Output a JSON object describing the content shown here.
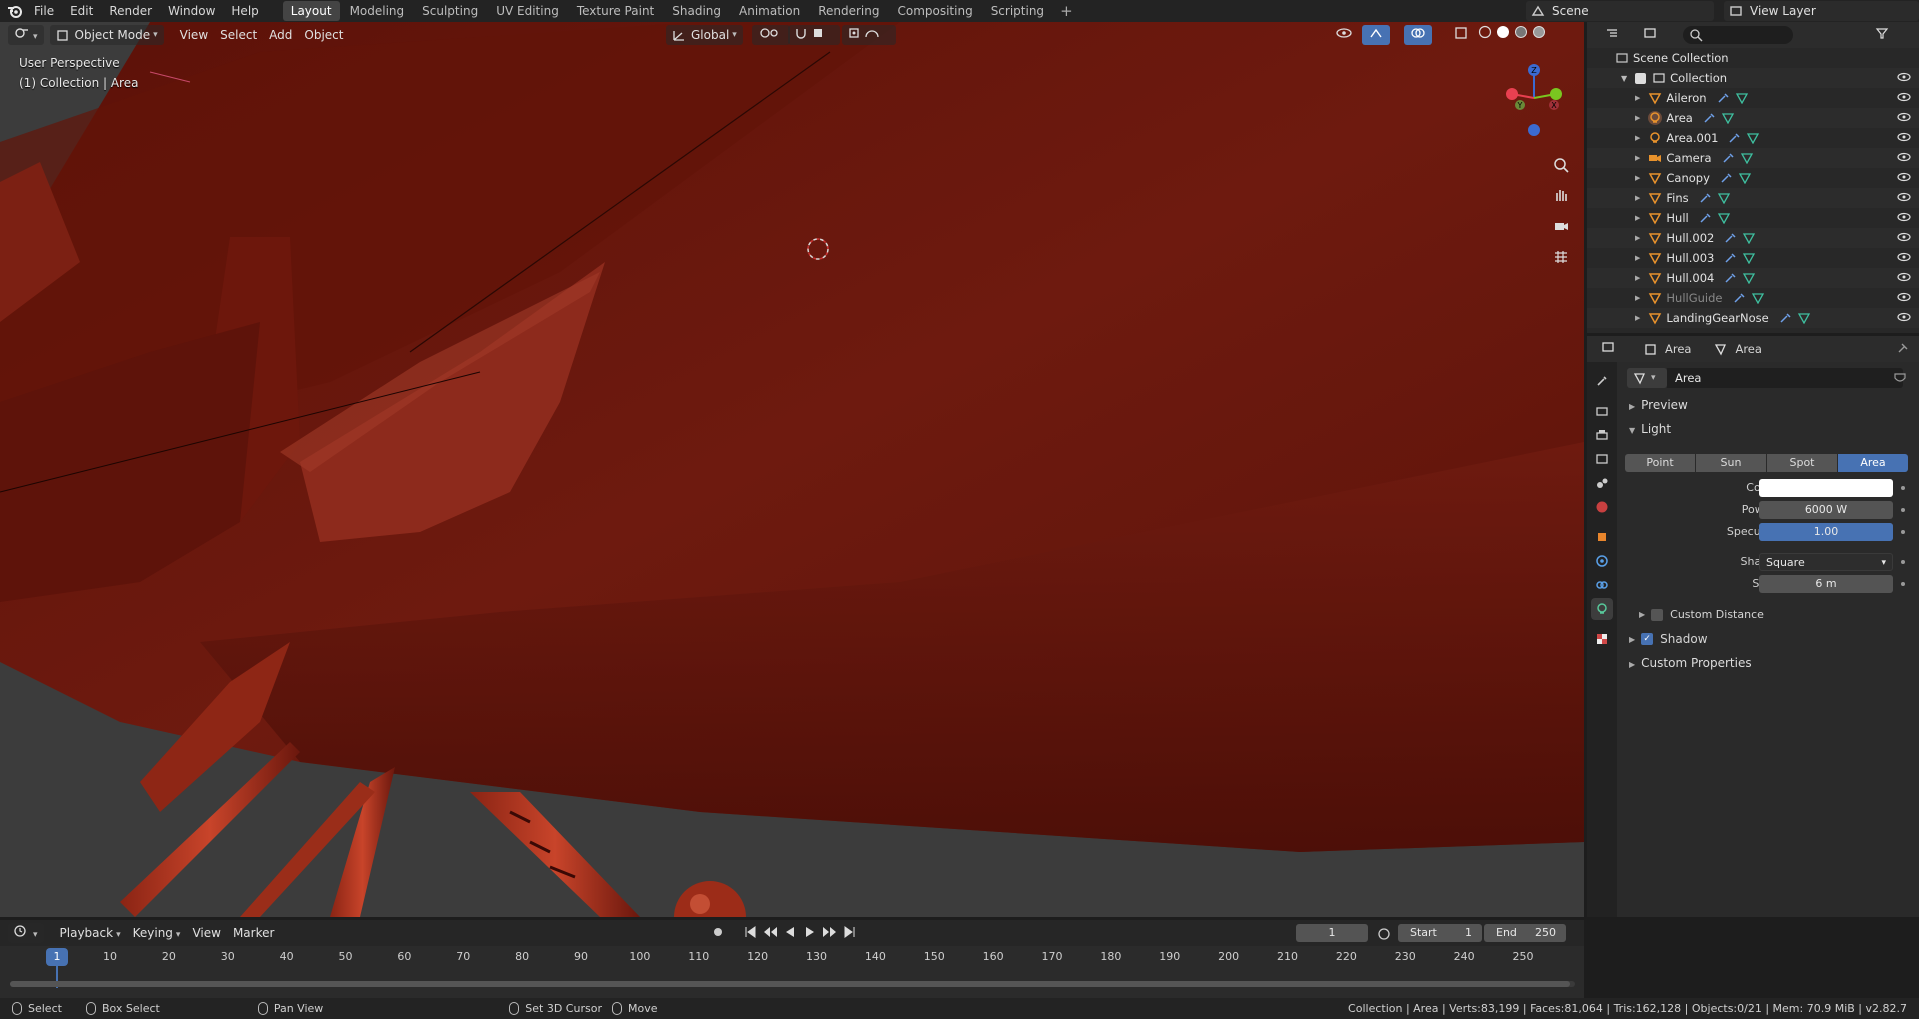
{
  "topbar": {
    "menus": [
      "File",
      "Edit",
      "Render",
      "Window",
      "Help"
    ],
    "workspaces": [
      "Layout",
      "Modeling",
      "Sculpting",
      "UV Editing",
      "Texture Paint",
      "Shading",
      "Animation",
      "Rendering",
      "Compositing",
      "Scripting"
    ],
    "active_workspace": "Layout",
    "add_tab": "+",
    "scene": "Scene",
    "view_layer": "View Layer"
  },
  "viewport": {
    "mode": "Object Mode",
    "menus": [
      "View",
      "Select",
      "Add",
      "Object"
    ],
    "orientation": "Global",
    "perspective_label": "User Perspective",
    "collection_label": "(1) Collection | Area",
    "gizmo_axes": {
      "x": "X",
      "y": "Y",
      "z": "Z"
    },
    "model_color": "#7a1a10"
  },
  "outliner": {
    "root": "Scene Collection",
    "collection": "Collection",
    "items": [
      {
        "name": "Aileron",
        "icon": "mesh-icon"
      },
      {
        "name": "Area",
        "icon": "light-icon"
      },
      {
        "name": "Area.001",
        "icon": "light-icon"
      },
      {
        "name": "Camera",
        "icon": "camera-icon"
      },
      {
        "name": "Canopy",
        "icon": "mesh-icon"
      },
      {
        "name": "Fins",
        "icon": "mesh-icon"
      },
      {
        "name": "Hull",
        "icon": "mesh-icon"
      },
      {
        "name": "Hull.002",
        "icon": "mesh-icon"
      },
      {
        "name": "Hull.003",
        "icon": "mesh-icon"
      },
      {
        "name": "Hull.004",
        "icon": "mesh-icon"
      },
      {
        "name": "HullGuide",
        "icon": "mesh-icon"
      },
      {
        "name": "LandingGearNose",
        "icon": "mesh-icon"
      }
    ]
  },
  "properties": {
    "breadcrumb_object": "Area",
    "breadcrumb_data": "Area",
    "datablock": "Area",
    "preview_label": "Preview",
    "light_label": "Light",
    "light_types": [
      "Point",
      "Sun",
      "Spot",
      "Area"
    ],
    "active_light_type": "Area",
    "color_label": "Color",
    "color_value": "#ffffff",
    "power_label": "Power",
    "power_value": "6000 W",
    "specular_label": "Specular",
    "specular_value": "1.00",
    "specular_fraction": 1.0,
    "shape_label": "Shape",
    "shape_value": "Square",
    "size_label": "Size",
    "size_value": "6 m",
    "custom_distance_label": "Custom Distance",
    "shadow_label": "Shadow",
    "custom_props_label": "Custom Properties"
  },
  "timeline": {
    "menus": [
      "Playback",
      "Keying",
      "View",
      "Marker"
    ],
    "current_frame": "1",
    "start_label": "Start",
    "start_value": "1",
    "end_label": "End",
    "end_value": "250",
    "ticks": [
      "1",
      "10",
      "20",
      "30",
      "40",
      "50",
      "60",
      "70",
      "80",
      "90",
      "100",
      "110",
      "120",
      "130",
      "140",
      "150",
      "160",
      "170",
      "180",
      "190",
      "200",
      "210",
      "220",
      "230",
      "240",
      "250"
    ]
  },
  "statusbar": {
    "select": "Select",
    "box_select": "Box Select",
    "pan_view": "Pan View",
    "set_cursor": "Set 3D Cursor",
    "move": "Move",
    "stats": "Collection | Area | Verts:83,199 | Faces:81,064 | Tris:162,128 | Objects:0/21 | Mem: 70.9 MiB | v2.82.7"
  }
}
